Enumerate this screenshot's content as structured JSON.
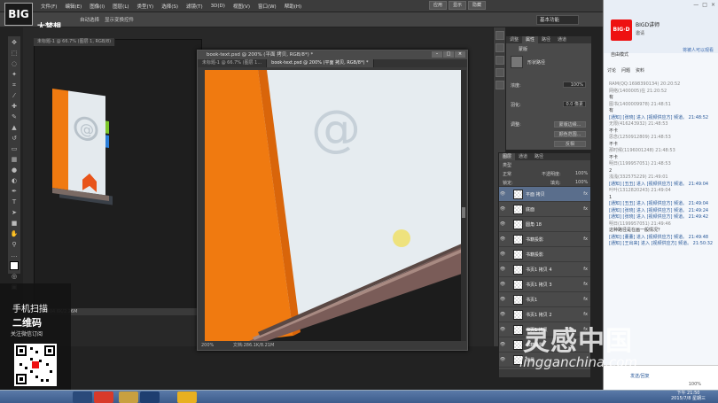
{
  "menubar": {
    "logo": "BIG",
    "items": [
      "文件(F)",
      "编辑(E)",
      "图像(I)",
      "图层(L)",
      "类型(Y)",
      "选择(S)",
      "滤镜(T)",
      "3D(D)",
      "视图(V)",
      "窗口(W)",
      "帮助(H)"
    ],
    "controls": [
      "应用",
      "显示",
      "隐藏"
    ]
  },
  "optbar": {
    "brand": "大梦想",
    "auto_select": "自动选择",
    "transform": "显示变换控件",
    "workspace": "基本功能"
  },
  "doc1": {
    "tabs": [
      "未标题-1 @ 66.7% (图层 1, RGB/8)",
      "book-text.psd @ ..."
    ],
    "status": "文档:404.6K/2.26M"
  },
  "doc2": {
    "title": "book-text.psd @ 200% (平面 拷贝, RGB/8*) *",
    "tabs": [
      "未标题-1 @ 66.7% (图层 1...",
      "book-text.psd @ 200% (平面 拷贝, RGB/8*) *"
    ],
    "status_zoom": "200%",
    "status_doc": "文档:286.1K/8.21M"
  },
  "properties": {
    "tabs": [
      "调整",
      "属性",
      "路径",
      "通道"
    ],
    "title": "蒙版",
    "kind": "形状路径",
    "density_label": "浓度:",
    "density_value": "100%",
    "feather_label": "羽化:",
    "feather_value": "0.0 像素",
    "refine_label": "调整:",
    "buttons": [
      "蒙版边缘...",
      "颜色范围...",
      "反相"
    ]
  },
  "layers": {
    "tabs": [
      "图层",
      "通道",
      "路径"
    ],
    "kind": "类型",
    "blend": "正常",
    "opacity_label": "不透明度:",
    "opacity_value": "100%",
    "lock_label": "锁定:",
    "fill_label": "填充:",
    "fill_value": "100%",
    "items": [
      {
        "name": "平面 拷贝",
        "fx": "fx",
        "selected": true
      },
      {
        "name": "底面",
        "fx": "fx",
        "selected": false
      },
      {
        "name": "圆角 18",
        "fx": "",
        "selected": false
      },
      {
        "name": "书籍投影",
        "fx": "fx",
        "selected": false
      },
      {
        "name": "书籍投影",
        "fx": "",
        "selected": false
      },
      {
        "name": "书页1 拷贝 4",
        "fx": "fx",
        "selected": false
      },
      {
        "name": "书页1 拷贝 3",
        "fx": "fx",
        "selected": false
      },
      {
        "name": "书页1",
        "fx": "fx",
        "selected": false
      },
      {
        "name": "书页1 拷贝 2",
        "fx": "fx",
        "selected": false
      },
      {
        "name": "书页1 拷贝",
        "fx": "fx",
        "selected": false
      },
      {
        "name": "书籍投影",
        "fx": "",
        "selected": false
      },
      {
        "name": "背景",
        "fx": "",
        "selected": false
      }
    ]
  },
  "chat": {
    "logo": "BIG·D",
    "name": "BIGD讲师",
    "sub": "邀请",
    "top_controls": [
      "—",
      "□",
      "×"
    ],
    "link": "将被人可以观看",
    "mode_label": "自由模式",
    "tabs": [
      "讨论",
      "问题",
      "资料"
    ],
    "messages": [
      {
        "type": "meta",
        "text": "RAM(QQ:1698390134) 20:20:52"
      },
      {
        "type": "meta",
        "text": "网络(1400005)在 21:20:52"
      },
      {
        "type": "text",
        "text": "有"
      },
      {
        "type": "meta",
        "text": "图书(1400009978) 21:48:51"
      },
      {
        "type": "text",
        "text": "有"
      },
      {
        "type": "sys",
        "text": "[通知] [张晓] 进入 [视频供应方] 频道。 21:48:52"
      },
      {
        "type": "meta",
        "text": "无限(416243932) 21:48:53"
      },
      {
        "type": "text",
        "text": "不卡"
      },
      {
        "type": "meta",
        "text": "思念(1250912809) 21:48:53"
      },
      {
        "type": "text",
        "text": "不卡"
      },
      {
        "type": "meta",
        "text": "那时候(1196001248) 21:48:53"
      },
      {
        "type": "text",
        "text": "不卡"
      },
      {
        "type": "meta",
        "text": "明日(1199957051) 21:48:53"
      },
      {
        "type": "text",
        "text": "2"
      },
      {
        "type": "meta",
        "text": "浅浅(332575229) 21:49:01"
      },
      {
        "type": "sys",
        "text": "[通知] [丑丑] 进入 [视频供应方] 频道。 21:49:04"
      },
      {
        "type": "meta",
        "text": "叶叶(1312820243) 21:49:04"
      },
      {
        "type": "text",
        "text": "1"
      },
      {
        "type": "sys",
        "text": "[通知] [丑丑] 进入 [视频供应方] 频道。 21:49:04"
      },
      {
        "type": "sys",
        "text": "[通知] [张晓] 进入 [视频供应方] 频道。 21:49:24"
      },
      {
        "type": "sys",
        "text": "[通知] [张晓] 进入 [视频供应方] 频道。 21:49:42"
      },
      {
        "type": "meta",
        "text": "明日(1199957051) 21:49:46"
      },
      {
        "type": "text",
        "text": "这种路径是在画一般情况？"
      },
      {
        "type": "sys",
        "text": "[通知] [董董] 进入 [视频供应方] 频道。 21:49:48"
      },
      {
        "type": "sys",
        "text": "[通知] [王出来] 进入 [视频供应方] 频道。 21:50:32"
      }
    ],
    "input_hint": "发送/回复",
    "zoom": "100%"
  },
  "promo": {
    "line1": "手机扫描",
    "line2": "二维码",
    "line3": "关注微信订阅"
  },
  "watermark": {
    "big": "灵感中国",
    "small": "lingganchina.com"
  },
  "taskbar": {
    "time": "下午 21:50",
    "date": "2015/7/8 星期三"
  },
  "colors": {
    "book_orange": "#f07a10",
    "book_cover": "#e4eaee",
    "tab_green": "#7cc62a",
    "tab_blue": "#2a7dd8",
    "tab_red": "#d83a2a",
    "chat_logo": "#e11111",
    "selected_layer": "#5a6e8c"
  }
}
